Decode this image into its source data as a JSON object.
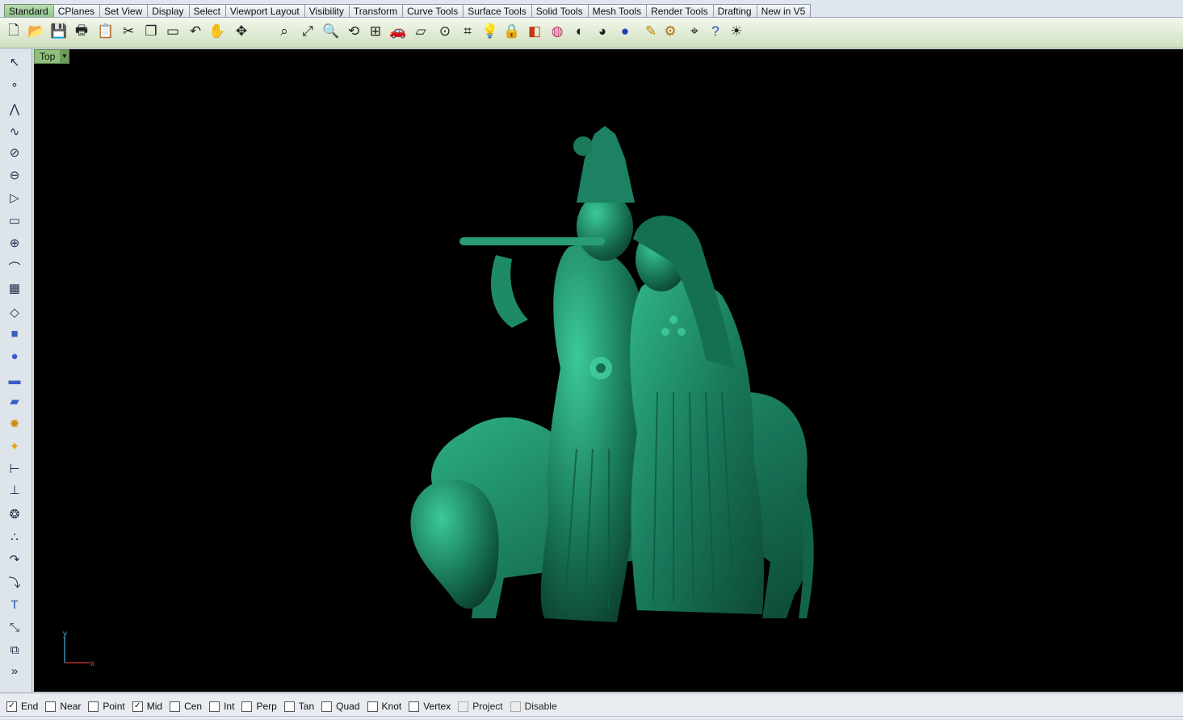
{
  "tabs": [
    {
      "label": "Standard",
      "active": true
    },
    {
      "label": "CPlanes"
    },
    {
      "label": "Set View"
    },
    {
      "label": "Display"
    },
    {
      "label": "Select"
    },
    {
      "label": "Viewport Layout"
    },
    {
      "label": "Visibility"
    },
    {
      "label": "Transform"
    },
    {
      "label": "Curve Tools"
    },
    {
      "label": "Surface Tools"
    },
    {
      "label": "Solid Tools"
    },
    {
      "label": "Mesh Tools"
    },
    {
      "label": "Render Tools"
    },
    {
      "label": "Drafting"
    },
    {
      "label": "New in V5"
    }
  ],
  "toolbar_icons": [
    "new-icon",
    "open-icon",
    "save-icon",
    "print-icon",
    "paste-icon",
    "cut-icon",
    "copy-icon",
    "clipboard-icon",
    "undo-icon",
    "pan-icon",
    "rotate-view-icon",
    "zoom-window-icon",
    "zoom-extents-icon",
    "zoom-selected-icon",
    "zoom-rotate-icon",
    "four-viewports-icon",
    "car-icon",
    "plane-icon",
    "point-icon",
    "grid-icon",
    "light-bulb-icon",
    "lock-icon",
    "layer-icon",
    "color-wheel-icon",
    "shade-icon",
    "render-sphere-icon",
    "blue-sphere-icon",
    "gumball-icon",
    "settings-gear-icon",
    "dimension-icon",
    "help-icon",
    "tips-icon"
  ],
  "left_icons": [
    "select-arrow-icon",
    "point-icon",
    "polyline-icon",
    "curve-icon",
    "circle-icon",
    "ellipse-icon",
    "polygon-icon",
    "rectangle-icon",
    "arc-icon",
    "fillet-icon",
    "surface-grid-icon",
    "surface-edit-icon",
    "box-icon",
    "sphere-icon",
    "cylinder-icon",
    "mesh-plane-icon",
    "gear-solid-icon",
    "explode-icon",
    "dimension-icon",
    "trim-icon",
    "boolean-icon",
    "spheres-icon",
    "curve-fillet-icon",
    "offset-icon",
    "text-icon",
    "scale-icon",
    "group-icon",
    "more-icon"
  ],
  "viewport": {
    "title": "Top",
    "background": "#000000",
    "model_color": "#1a7a5c"
  },
  "osnaps": [
    {
      "label": "End",
      "checked": true
    },
    {
      "label": "Near",
      "checked": false
    },
    {
      "label": "Point",
      "checked": false
    },
    {
      "label": "Mid",
      "checked": true
    },
    {
      "label": "Cen",
      "checked": false
    },
    {
      "label": "Int",
      "checked": false
    },
    {
      "label": "Perp",
      "checked": false
    },
    {
      "label": "Tan",
      "checked": false
    },
    {
      "label": "Quad",
      "checked": false
    },
    {
      "label": "Knot",
      "checked": false
    },
    {
      "label": "Vertex",
      "checked": false
    },
    {
      "label": "Project",
      "checked": false,
      "disabled": true
    },
    {
      "label": "Disable",
      "checked": false,
      "disabled": true
    }
  ],
  "axis": {
    "x": "x",
    "y": "y"
  },
  "more_label": "»"
}
